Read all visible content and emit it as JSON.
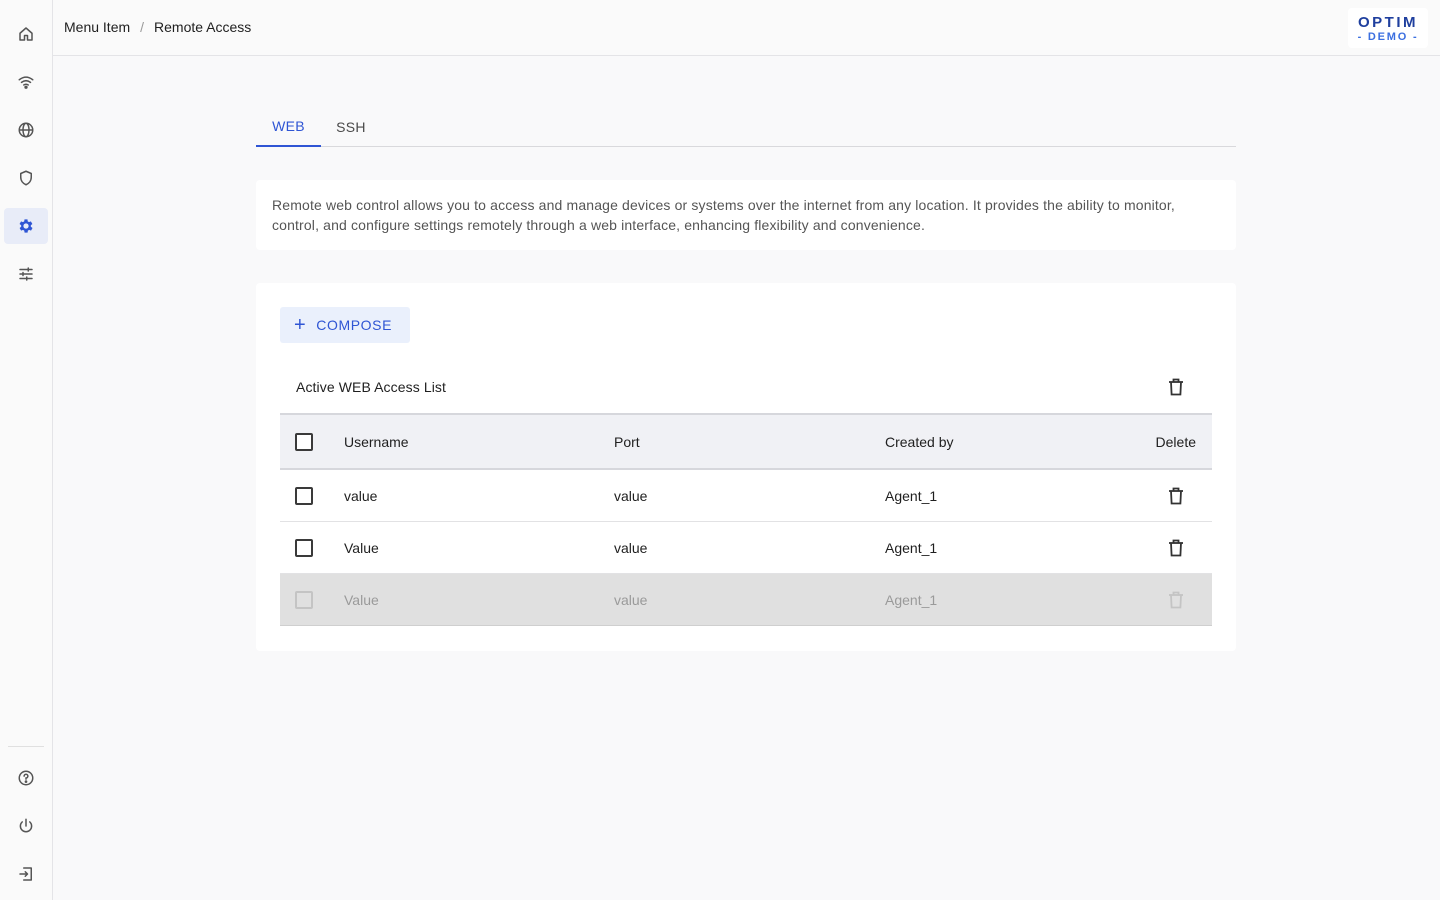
{
  "sidebar": {
    "top_items": [
      {
        "icon": "home-icon",
        "active": false
      },
      {
        "icon": "wifi-icon",
        "active": false
      },
      {
        "icon": "globe-icon",
        "active": false
      },
      {
        "icon": "shield-icon",
        "active": false
      },
      {
        "icon": "gear-icon",
        "active": true
      },
      {
        "icon": "sliders-icon",
        "active": false
      }
    ],
    "bottom_items": [
      {
        "icon": "help-icon"
      },
      {
        "icon": "power-icon"
      },
      {
        "icon": "logout-icon"
      }
    ],
    "accent_color": "#2f55d4"
  },
  "header": {
    "breadcrumb": [
      "Menu Item",
      "Remote Access"
    ],
    "breadcrumb_separator": "/",
    "logo_line1": "OPTIM",
    "logo_line2": "- DEMO -"
  },
  "tabs": [
    {
      "label": "WEB",
      "active": true
    },
    {
      "label": "SSH",
      "active": false
    }
  ],
  "description": "Remote web control allows you to access and manage devices or systems over the internet from any location. It provides the ability to monitor, control, and configure settings remotely through a web interface, enhancing flexibility and convenience.",
  "compose": {
    "label": "COMPOSE"
  },
  "list": {
    "title": "Active WEB Access List",
    "columns": {
      "username": "Username",
      "port": "Port",
      "created_by": "Created by",
      "delete": "Delete"
    },
    "rows": [
      {
        "username": "value",
        "port": "value",
        "created_by": "Agent_1",
        "disabled": false
      },
      {
        "username": "Value",
        "port": "value",
        "created_by": "Agent_1",
        "disabled": false
      },
      {
        "username": "Value",
        "port": "value",
        "created_by": "Agent_1",
        "disabled": true
      }
    ]
  }
}
